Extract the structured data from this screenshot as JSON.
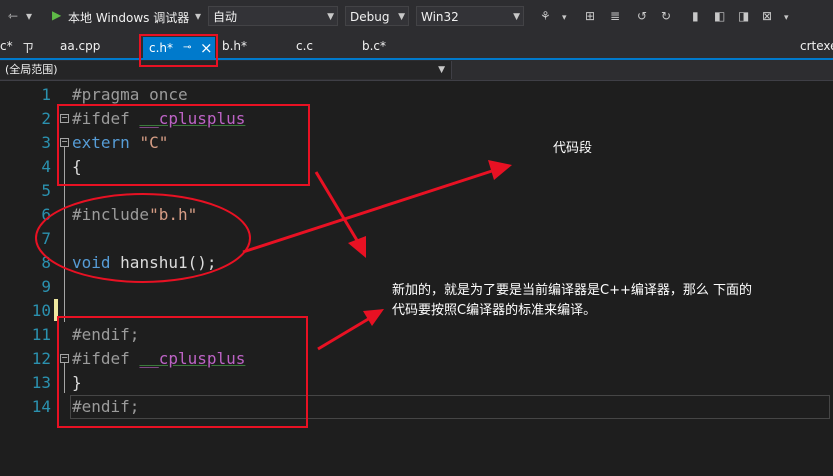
{
  "toolbar": {
    "run_label": "本地 Windows 调试器",
    "config_combo": "自动",
    "build_config": "Debug",
    "platform": "Win32",
    "icons": [
      "nav-back-icon",
      "nav-forward-icon",
      "play-icon",
      "bookmark-icon"
    ]
  },
  "tabs": {
    "left_cut": "c*",
    "pin_glyph": "ㄗ",
    "items": [
      {
        "label": "aa.cpp"
      },
      {
        "label": "c.h*"
      },
      {
        "label": "b.h*"
      },
      {
        "label": "c.c"
      },
      {
        "label": "b.c*"
      },
      {
        "label": "crtexe"
      }
    ],
    "close_glyph": "×",
    "active_pin": "⊸"
  },
  "scope": {
    "label": "(全局范围)"
  },
  "editor": {
    "line_numbers": [
      "1",
      "2",
      "3",
      "4",
      "5",
      "6",
      "7",
      "8",
      "9",
      "10",
      "11",
      "12",
      "13",
      "14"
    ],
    "lines": {
      "l1": "#pragma once",
      "l2_pp": "#ifdef ",
      "l2_macro": "__cplusplus",
      "l3_kw": "extern ",
      "l3_str": "\"C\"",
      "l4": "{",
      "l6_pp": "#include",
      "l6_str": "\"b.h\"",
      "l8_kw": "void ",
      "l8_rest": "hanshu1();",
      "l11": "#endif;",
      "l12_pp": "#ifdef ",
      "l12_macro": "__cplusplus",
      "l13": "}",
      "l14": "#endif;"
    }
  },
  "annotations": {
    "code_segment": "代码段",
    "explanation_line1": "新加的，就是为了要是当前编译器是C++编译器，那么 下面的",
    "explanation_line2": "代码要按照C编译器的标准来编译。"
  },
  "colors": {
    "accent": "#007acc",
    "annotation_red": "#e81123",
    "background": "#1e1e1e"
  }
}
